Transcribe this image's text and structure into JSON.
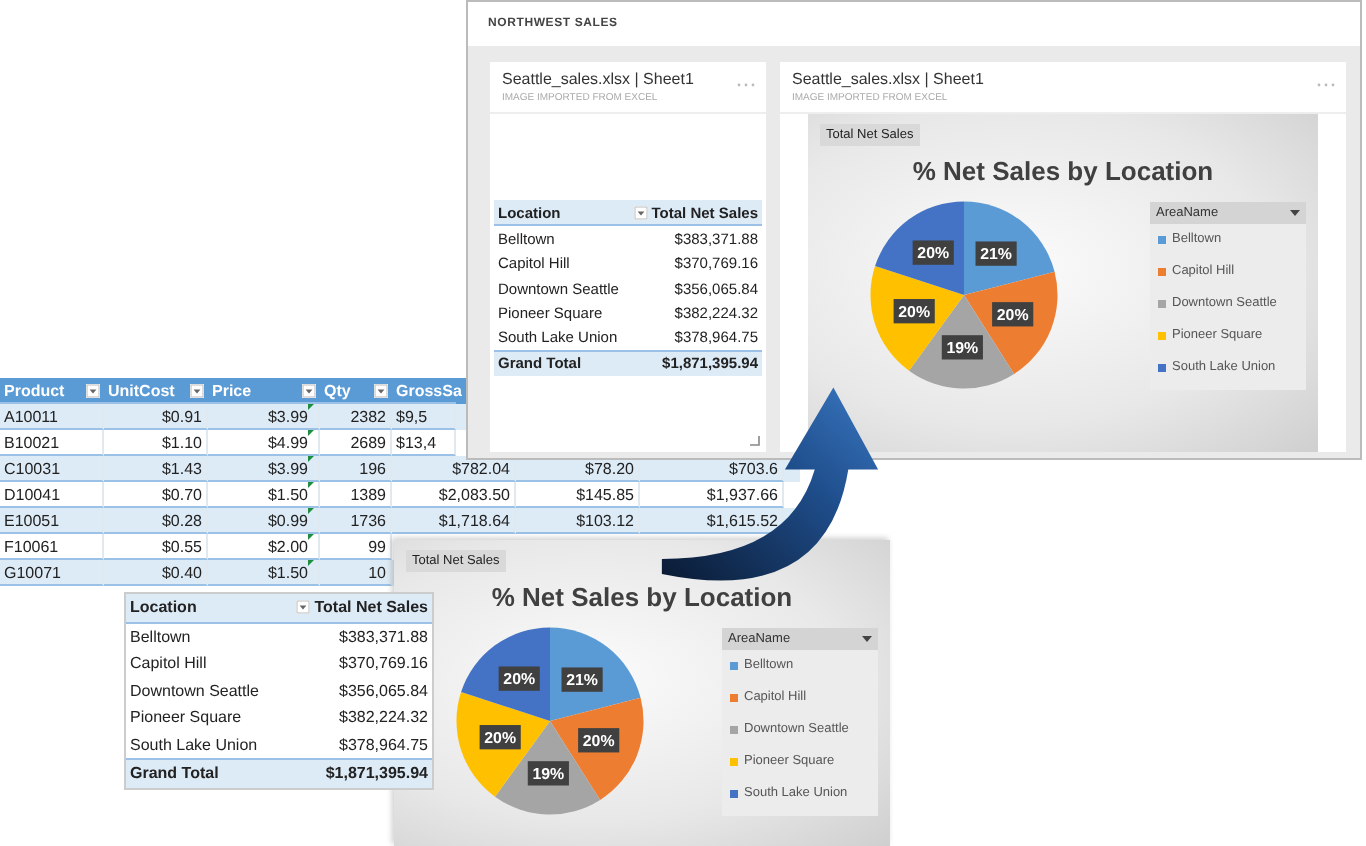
{
  "excel_table": {
    "columns": [
      "Product",
      "UnitCost",
      "Price",
      "Qty",
      "GrossSa"
    ],
    "rows": [
      {
        "cells": [
          "A10011",
          "$0.91",
          "$3.99",
          "2382",
          "$9,5"
        ]
      },
      {
        "cells": [
          "B10021",
          "$1.10",
          "$4.99",
          "2689",
          "$13,4"
        ]
      },
      {
        "cells": [
          "C10031",
          "$1.43",
          "$3.99",
          "196",
          "$782.04",
          "$78.20",
          "$703.6"
        ]
      },
      {
        "cells": [
          "D10041",
          "$0.70",
          "$1.50",
          "1389",
          "$2,083.50",
          "$145.85",
          "$1,937.66"
        ]
      },
      {
        "cells": [
          "E10051",
          "$0.28",
          "$0.99",
          "1736",
          "$1,718.64",
          "$103.12",
          "$1,615.52"
        ]
      },
      {
        "cells": [
          "F10061",
          "$0.55",
          "$2.00",
          "99"
        ]
      },
      {
        "cells": [
          "G10071",
          "$0.40",
          "$1.50",
          "10"
        ]
      }
    ]
  },
  "dashboard": {
    "title": "NORTHWEST SALES",
    "tiles": [
      {
        "kind": "table",
        "title": "Seattle_sales.xlsx | Sheet1",
        "subtitle": "IMAGE IMPORTED FROM EXCEL",
        "pivot": {
          "columns": [
            "Location",
            "Total Net Sales"
          ],
          "rows": [
            {
              "location": "Belltown",
              "value": "$383,371.88"
            },
            {
              "location": "Capitol Hill",
              "value": "$370,769.16"
            },
            {
              "location": "Downtown Seattle",
              "value": "$356,065.84"
            },
            {
              "location": "Pioneer Square",
              "value": "$382,224.32"
            },
            {
              "location": "South Lake Union",
              "value": "$378,964.75"
            }
          ],
          "total": {
            "label": "Grand Total",
            "value": "$1,871,395.94"
          }
        }
      },
      {
        "kind": "chart",
        "title": "Seattle_sales.xlsx | Sheet1",
        "subtitle": "IMAGE IMPORTED FROM EXCEL",
        "chart": {
          "chart_data": {
            "type": "pie",
            "title": "% Net Sales by Location",
            "categories": [
              "Belltown",
              "Capitol Hill",
              "Downtown Seattle",
              "Pioneer Square",
              "South Lake Union"
            ],
            "series": [
              {
                "name": "Total Net Sales",
                "values": [
                  21,
                  20,
                  19,
                  20,
                  20
                ]
              }
            ],
            "value_labels": [
              "21%",
              "20%",
              "19%",
              "20%",
              "20%"
            ]
          },
          "legend": {
            "title": "AreaName",
            "items": [
              {
                "color": "#5b9bd5"
              },
              {
                "color": "#ed7d31"
              },
              {
                "color": "#a5a5a5"
              },
              {
                "color": "#ffc000"
              },
              {
                "color": "#4472c4"
              }
            ]
          }
        }
      }
    ]
  },
  "pivot_table": {
    "columns": [
      "Location",
      "Total Net Sales"
    ],
    "rows": [
      {
        "location": "Belltown",
        "value": "$383,371.88"
      },
      {
        "location": "Capitol Hill",
        "value": "$370,769.16"
      },
      {
        "location": "Downtown Seattle",
        "value": "$356,065.84"
      },
      {
        "location": "Pioneer Square",
        "value": "$382,224.32"
      },
      {
        "location": "South Lake Union",
        "value": "$378,964.75"
      }
    ],
    "total": {
      "label": "Grand Total",
      "value": "$1,871,395.94"
    }
  },
  "chart_image": {
    "chart_data": {
      "type": "pie",
      "title": "% Net Sales by Location",
      "categories": [
        "Belltown",
        "Capitol Hill",
        "Downtown Seattle",
        "Pioneer Square",
        "South Lake Union"
      ],
      "series": [
        {
          "name": "Total Net Sales",
          "values": [
            21,
            20,
            19,
            20,
            20
          ]
        }
      ],
      "value_labels": [
        "21%",
        "20%",
        "19%",
        "20%",
        "20%"
      ]
    },
    "legend": {
      "title": "AreaName",
      "items": [
        {
          "color": "#5b9bd5"
        },
        {
          "color": "#ed7d31"
        },
        {
          "color": "#a5a5a5"
        },
        {
          "color": "#ffc000"
        },
        {
          "color": "#4472c4"
        }
      ]
    }
  }
}
